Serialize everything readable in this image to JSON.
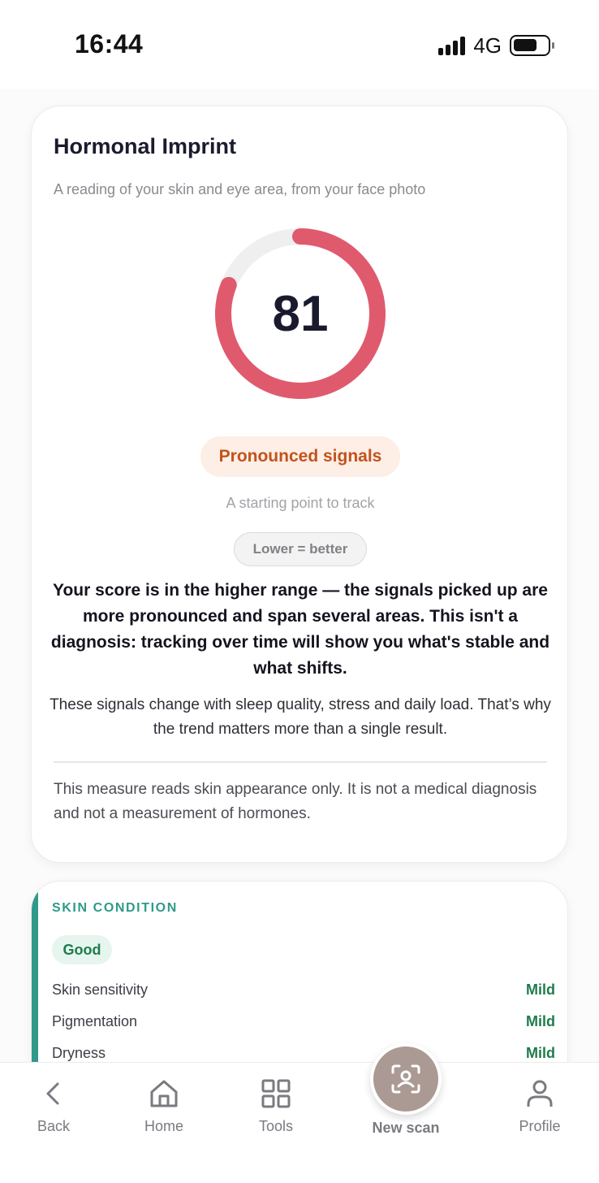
{
  "status_bar": {
    "time": "16:44",
    "network": "4G"
  },
  "card": {
    "title": "Hormonal Imprint",
    "subtitle": "A reading of your skin and eye area, from your face photo",
    "score": "81",
    "score_progress_percent": 81,
    "ring_color": "#e05a6e",
    "ring_track_color": "#efefef",
    "status_label": "Pronounced signals",
    "status_note": "A starting point to track",
    "direction_label": "Lower = better",
    "summary": "Your score is in the higher range — the signals picked up are more pronounced and span several areas. This isn't a diagnosis: tracking over time will show you what's stable and what shifts.",
    "detail": "These signals change with sleep quality, stress and daily load. That’s why the trend matters more than a single result.",
    "disclaimer": "This measure reads skin appearance only. It is not a medical diagnosis and not a measurement of hormones."
  },
  "skin_condition": {
    "title": "SKIN CONDITION",
    "status": "Good",
    "accent_color": "#2f9a8a",
    "metrics": [
      {
        "label": "Skin sensitivity",
        "value": "Mild"
      },
      {
        "label": "Pigmentation",
        "value": "Mild"
      },
      {
        "label": "Dryness",
        "value": "Mild"
      }
    ]
  },
  "nav": {
    "back": "Back",
    "home": "Home",
    "tools": "Tools",
    "new_scan": "New scan",
    "profile": "Profile"
  }
}
